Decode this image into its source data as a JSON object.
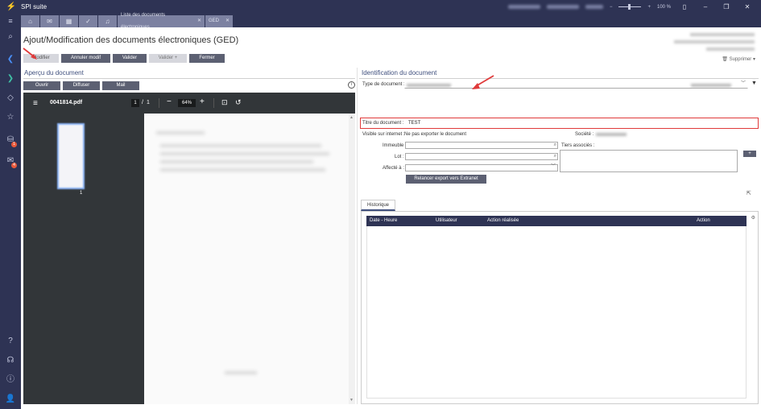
{
  "app": {
    "title": "SPI suite",
    "zoom": "100 %"
  },
  "tabs": [
    {
      "name": "home",
      "icon": "home-icon"
    },
    {
      "name": "mail",
      "icon": "mail-icon"
    },
    {
      "name": "calendar",
      "icon": "calendar-icon"
    },
    {
      "name": "tasks",
      "icon": "check-icon"
    },
    {
      "name": "notifications",
      "icon": "bell-icon"
    }
  ],
  "doc_tabs": [
    {
      "label": "Liste des documents électroniques"
    },
    {
      "label": "GED"
    }
  ],
  "sidebar": {
    "badges": [
      "1",
      "4"
    ]
  },
  "page": {
    "title": "Ajout/Modification des documents électroniques (GED)",
    "supprimer": "Supprimer"
  },
  "toolbar": {
    "modifier": "Modifier",
    "annuler": "Annuler modif",
    "valider": "Valider",
    "valider_plus": "Valider +",
    "fermer": "Fermer"
  },
  "preview": {
    "title": "Aperçu du document",
    "ouvrir": "Ouvrir",
    "diffuser": "Diffuser",
    "mail": "Mail",
    "pdf": {
      "filename": "0041814.pdf",
      "page_current": "1",
      "page_sep": "/",
      "page_total": "1",
      "zoom": "64%",
      "thumb_number": "1"
    }
  },
  "ident": {
    "title": "Identification du document",
    "type_label": "Type de document :",
    "titre_label": "Titre du document :",
    "titre_value": "TEST",
    "visible_label": "Visible sur internet :",
    "visible_value": "Ne pas exporter le document",
    "societe_label": "Société :",
    "immeuble_label": "Immeuble :",
    "lot_label": "Lot :",
    "affecte_label": "Affecté à :",
    "tiers_label": "Tiers associés :",
    "plus": "+",
    "relancer": "Relancer export vers Extranet"
  },
  "historique": {
    "tab": "Historique",
    "columns": [
      "Date - Heure",
      "Utilisateur",
      "Action réalisée",
      "Action"
    ]
  },
  "colors": {
    "accent": "#2e3354",
    "button": "#5c6072",
    "highlight": "#e03a3a"
  }
}
